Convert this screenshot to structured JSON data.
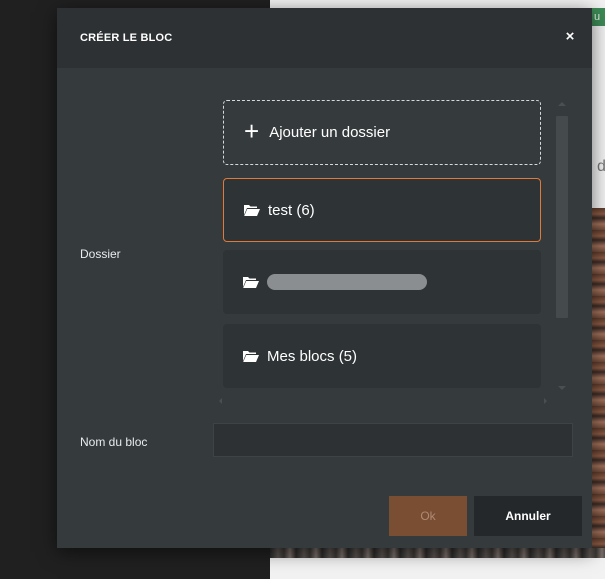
{
  "background": {
    "right_fragment_text": "de",
    "top_strip_text": "u"
  },
  "modal": {
    "title": "CRÉER LE BLOC",
    "close_symbol": "×",
    "folder_label": "Dossier",
    "name_label": "Nom du bloc",
    "name_value": "",
    "add_folder_label": "Ajouter un dossier",
    "folders": [
      {
        "label": "test (6)",
        "selected": true,
        "icon": "folder-open-icon"
      },
      {
        "label": "",
        "selected": false,
        "blurred": true,
        "icon": "folder-open-icon"
      },
      {
        "label": "Mes blocs (5)",
        "selected": false,
        "icon": "folder-open-icon"
      }
    ],
    "ok_label": "Ok",
    "cancel_label": "Annuler"
  },
  "colors": {
    "modal_bg": "#353a3d",
    "header_bg": "#2d3134",
    "accent_orange": "#e07a3a",
    "ok_button_bg": "#7a4e33",
    "cancel_button_bg": "#24282a"
  }
}
